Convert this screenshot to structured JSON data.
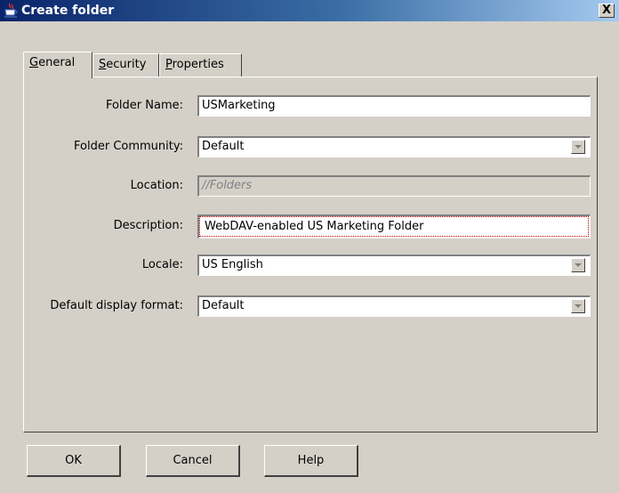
{
  "window": {
    "title": "Create folder",
    "close_symbol": "X"
  },
  "tabs": [
    {
      "prefix": "",
      "mnemonic": "G",
      "rest": "eneral",
      "active": true
    },
    {
      "prefix": "",
      "mnemonic": "S",
      "rest": "ecurity",
      "active": false
    },
    {
      "prefix": "",
      "mnemonic": "P",
      "rest": "roperties",
      "active": false
    }
  ],
  "form": {
    "folder_name": {
      "label": "Folder Name:",
      "value": "USMarketing"
    },
    "folder_community": {
      "label": "Folder Community:",
      "value": "Default"
    },
    "location": {
      "label": "Location:",
      "value": "//Folders"
    },
    "description": {
      "label": "Description:",
      "value": "WebDAV-enabled US Marketing Folder"
    },
    "locale": {
      "label": "Locale:",
      "value": "US English"
    },
    "default_display_format": {
      "label": "Default display format:",
      "value": "Default"
    }
  },
  "buttons": {
    "ok": "OK",
    "cancel": "Cancel",
    "help": "Help"
  },
  "icons": {
    "title_icon": "java-cup-icon",
    "dropdown_icon": "chevron-down-icon"
  },
  "colors": {
    "title_bar_start": "#0a246a",
    "title_bar_end": "#a6caf0",
    "face": "#d4d0c8"
  }
}
